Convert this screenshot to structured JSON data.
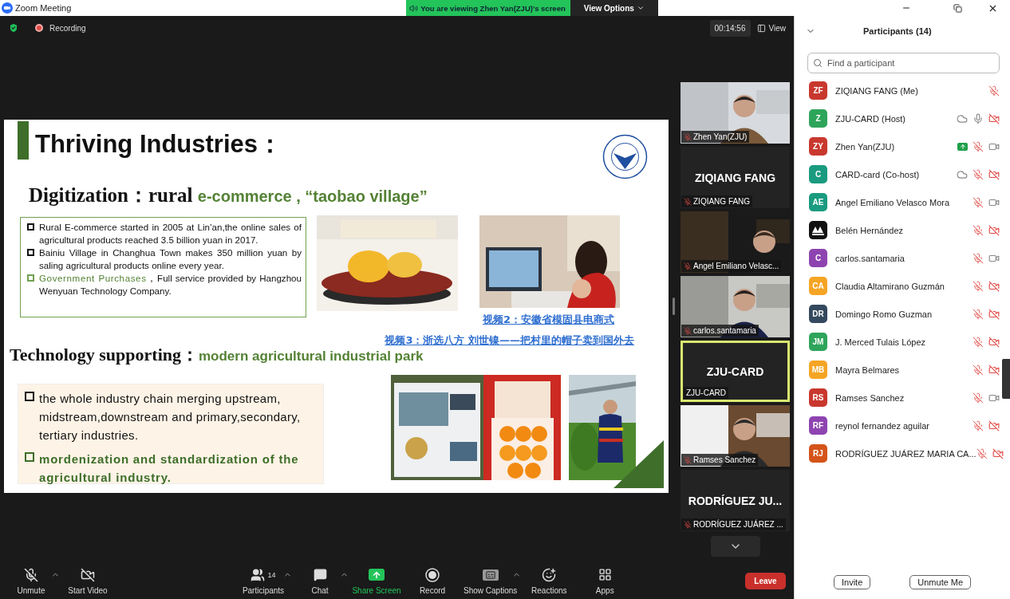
{
  "window": {
    "title": "Zoom Meeting"
  },
  "share_banner": {
    "text": "You are viewing Zhen Yan(ZJU)'s screen",
    "view_options": "View Options"
  },
  "top_bar": {
    "recording": "Recording",
    "timer": "00:14:56",
    "view": "View"
  },
  "slide": {
    "title": "Thriving Industries：",
    "section_1": {
      "heading": "Digitization：rural ",
      "highlight": "e-commerce , “taobao village”",
      "bullets": [
        {
          "kind": "plain",
          "text": "Rural E-commerce   started in 2005 at Lin’an,the online sales of agricultural products reached 3.5 billion yuan in 2017."
        },
        {
          "kind": "plain",
          "text": "Bainiu Village in Changhua Town makes 350 million yuan by saling agricultural products online every year."
        },
        {
          "kind": "highlight",
          "lead": "Government Purchases",
          "text": "，Full service provided by Hangzhou Wenyuan Technology Company."
        }
      ],
      "links": [
        "视频2：安徽省模固县电商式",
        "视频3：浙选八方 刘世镍——把村里的帽子卖到国外去"
      ]
    },
    "section_2": {
      "heading": "Technology supporting：",
      "highlight": "modern agricultural industrial park",
      "bullets": [
        {
          "kind": "plain",
          "text": "the whole industry chain merging upstream, midstream,downstream and primary,secondary, tertiary industries."
        },
        {
          "kind": "highlight",
          "text": "mordenization and standardization of the agricultural industry."
        }
      ]
    }
  },
  "video_tiles": [
    {
      "kind": "video",
      "name": "Zhen Yan(ZJU)",
      "muted": true,
      "active": false
    },
    {
      "kind": "name",
      "display": "ZIQIANG FANG",
      "name": "ZIQIANG FANG",
      "muted": true,
      "active": false
    },
    {
      "kind": "video",
      "name": "Angel Emiliano Velasc...",
      "muted": true,
      "active": false
    },
    {
      "kind": "video",
      "name": "carlos.santamaria",
      "muted": true,
      "active": false
    },
    {
      "kind": "name",
      "display": "ZJU-CARD",
      "name": "ZJU-CARD",
      "muted": false,
      "active": true
    },
    {
      "kind": "video",
      "name": "Ramses Sanchez",
      "muted": true,
      "active": false
    },
    {
      "kind": "name",
      "display": "RODRÍGUEZ  JU...",
      "name": "RODRÍGUEZ JUÁREZ ...",
      "muted": true,
      "active": false
    }
  ],
  "toolbar": {
    "items": [
      {
        "kind": "mic",
        "label": "Unmute",
        "caret": true
      },
      {
        "kind": "video",
        "label": "Start Video",
        "caret": false
      },
      {
        "kind": "participants",
        "label": "Participants",
        "count": "14",
        "caret": true
      },
      {
        "kind": "chat",
        "label": "Chat",
        "caret": true
      },
      {
        "kind": "share",
        "label": "Share Screen",
        "caret": false
      },
      {
        "kind": "record",
        "label": "Record",
        "caret": false
      },
      {
        "kind": "captions",
        "label": "Show Captions",
        "caret": true
      },
      {
        "kind": "reactions",
        "label": "Reactions",
        "caret": false
      },
      {
        "kind": "apps",
        "label": "Apps",
        "caret": false
      }
    ],
    "leave": "Leave"
  },
  "participants": {
    "title": "Participants (14)",
    "search": {
      "placeholder": "Find a participant"
    },
    "items": [
      {
        "kind": "initials",
        "initials": "ZF",
        "color": "#c9382e",
        "name": "ZIQIANG FANG (Me)",
        "recording": false,
        "sharing": false,
        "mic_muted": true
      },
      {
        "kind": "initials",
        "initials": "Z",
        "color": "#2ea55b",
        "name": "ZJU-CARD (Host)",
        "recording": true,
        "sharing": false,
        "mic_muted": false,
        "video_on": false
      },
      {
        "kind": "initials",
        "initials": "ZY",
        "color": "#c9382e",
        "name": "Zhen Yan(ZJU)",
        "recording": false,
        "sharing": true,
        "mic_muted": true,
        "video_on": true
      },
      {
        "kind": "initials",
        "initials": "C",
        "color": "#1a9b80",
        "name": "CARD-card (Co-host)",
        "recording": true,
        "sharing": false,
        "mic_muted": true,
        "video_on": false
      },
      {
        "kind": "initials",
        "initials": "AE",
        "color": "#1a9b80",
        "name": "Angel Emiliano Velasco Mora",
        "recording": false,
        "sharing": false,
        "mic_muted": true,
        "video_on": true
      },
      {
        "kind": "picture",
        "name": "Belén Hernández",
        "recording": false,
        "sharing": false,
        "mic_muted": true,
        "video_on": false
      },
      {
        "kind": "initials",
        "initials": "C",
        "color": "#8e44b0",
        "name": "carlos.santamaria",
        "recording": false,
        "sharing": false,
        "mic_muted": true,
        "video_on": true
      },
      {
        "kind": "initials",
        "initials": "CA",
        "color": "#f5a524",
        "name": "Claudia Altamirano Guzmán",
        "recording": false,
        "sharing": false,
        "mic_muted": true,
        "video_on": false
      },
      {
        "kind": "initials",
        "initials": "DR",
        "color": "#34495e",
        "name": "Domingo Romo Guzman",
        "recording": false,
        "sharing": false,
        "mic_muted": true,
        "video_on": false
      },
      {
        "kind": "initials",
        "initials": "JM",
        "color": "#2ea55b",
        "name": "J. Merced Tulais López",
        "recording": false,
        "sharing": false,
        "mic_muted": true,
        "video_on": false
      },
      {
        "kind": "initials",
        "initials": "MB",
        "color": "#f5a524",
        "name": "Mayra Belmares",
        "recording": false,
        "sharing": false,
        "mic_muted": true,
        "video_on": false
      },
      {
        "kind": "initials",
        "initials": "RS",
        "color": "#c9382e",
        "name": "Ramses Sanchez",
        "recording": false,
        "sharing": false,
        "mic_muted": true,
        "video_on": true
      },
      {
        "kind": "initials",
        "initials": "RF",
        "color": "#8e44b0",
        "name": "reynol fernandez aguilar",
        "recording": false,
        "sharing": false,
        "mic_muted": true,
        "video_on": false
      },
      {
        "kind": "initials",
        "initials": "RJ",
        "color": "#d4541a",
        "name": "RODRÍGUEZ JUÁREZ MARIA CA...",
        "recording": false,
        "sharing": false,
        "mic_muted": true,
        "video_on": false
      }
    ],
    "buttons": [
      "Invite",
      "Unmute Me"
    ]
  }
}
